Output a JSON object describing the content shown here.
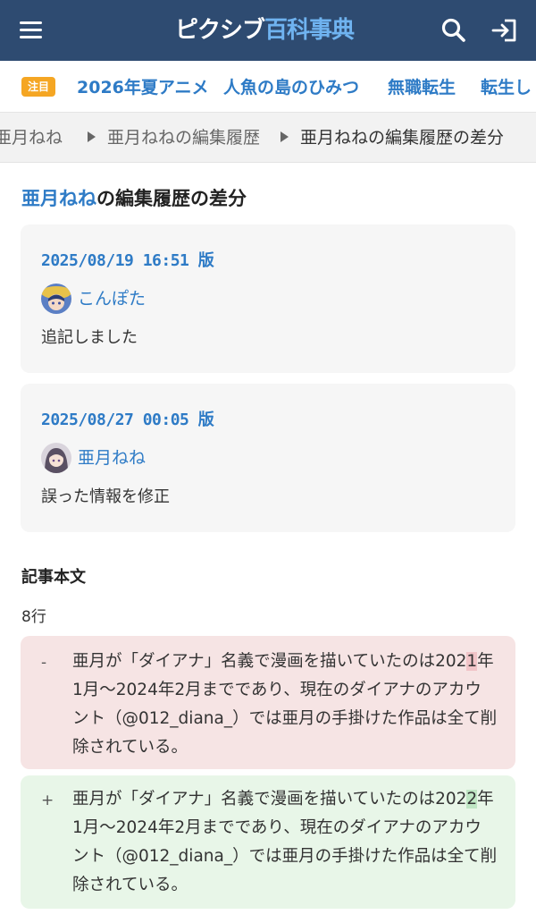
{
  "header": {
    "menu_icon": "hamburger-menu-icon",
    "logo_part1": "ピクシブ",
    "logo_part2": "百科事典",
    "search_icon": "search-icon",
    "login_icon": "login-icon"
  },
  "trending": {
    "badge": "注目",
    "tags": [
      "2026年夏アニメ",
      "人魚の島のひみつ",
      "無職転生",
      "転生し"
    ]
  },
  "breadcrumb": {
    "items": [
      "亜月ねね",
      "亜月ねねの編集履歴",
      "亜月ねねの編集履歴の差分"
    ]
  },
  "page": {
    "title_link": "亜月ねね",
    "title_rest": "の編集履歴の差分"
  },
  "revisions": [
    {
      "date": "2025/08/19 16:51 版",
      "user": "こんぽた",
      "comment": "追記しました"
    },
    {
      "date": "2025/08/27 00:05 版",
      "user": "亜月ねね",
      "comment": "誤った情報を修正"
    }
  ],
  "article": {
    "section_title": "記事本文",
    "line_count": "8行",
    "deleted": {
      "marker": "-",
      "before": "亜月が「ダイアナ」名義で漫画を描いていたのは202",
      "changed": "1",
      "after": "年1月〜2024年2月までであり、現在のダイアナのアカウント（@012_diana_）では亜月の手掛けた作品は全て削除されている。"
    },
    "added": {
      "marker": "+",
      "before": "亜月が「ダイアナ」名義で漫画を描いていたのは202",
      "changed": "2",
      "after": "年1月〜2024年2月までであり、現在のダイアナのアカウント（@012_diana_）では亜月の手掛けた作品は全て削除されている。"
    }
  }
}
